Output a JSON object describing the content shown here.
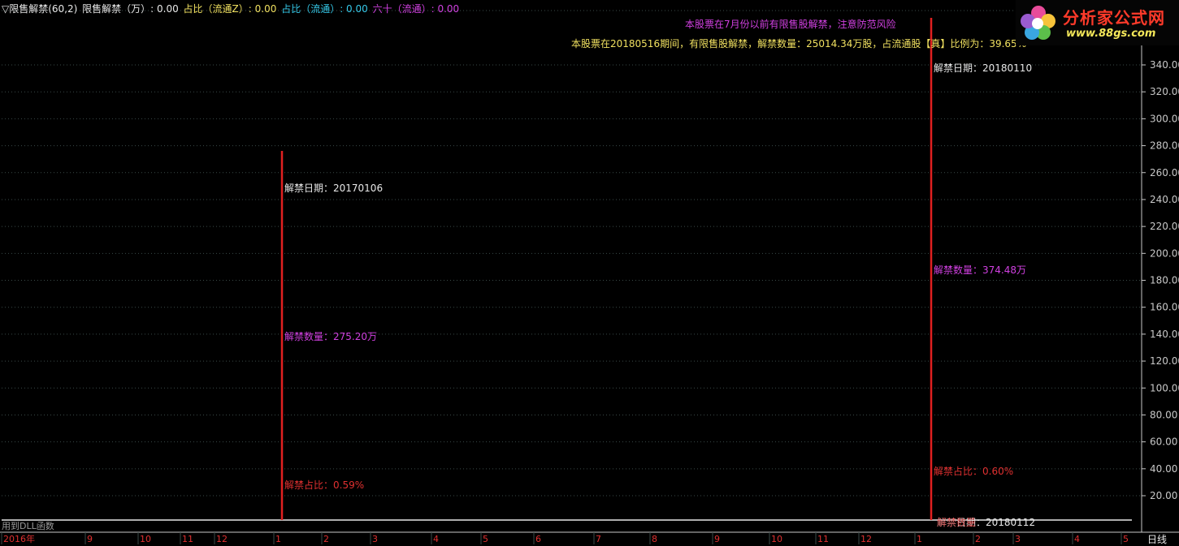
{
  "header": {
    "indicator": "▽限售解禁(60,2)",
    "items": [
      {
        "text": "限售解禁（万）: 0.00",
        "color": "#e8e8e8"
      },
      {
        "text": "占比（流通Z）: 0.00",
        "color": "#f0e060"
      },
      {
        "text": "占比（流通）: 0.00",
        "color": "#35c8e8"
      },
      {
        "text": "六十（流通）: 0.00",
        "color": "#d040e0"
      }
    ]
  },
  "notices": {
    "warning": "本股票在7月份以前有限售股解禁，注意防范风险",
    "detail": "本股票在20180516期间，有限售股解禁，解禁数量：25014.34万股，占流通股【真】比例为：39.65%"
  },
  "logo": {
    "brand": "分析家公式网",
    "url": "www.88gs.com",
    "icon": "flower-logo-icon"
  },
  "footer": {
    "dll_text": "用到DLL函数",
    "period": "日线"
  },
  "colors": {
    "grid": "#3a4a48",
    "axis": "#c8c8c8",
    "event_line": "#e02020",
    "label_white": "#e8e8e8",
    "label_mag": "#d040e0",
    "label_red": "#e03030"
  },
  "chart_data": {
    "type": "bar",
    "ylim": [
      0,
      380
    ],
    "y_ticks": [
      20,
      40,
      60,
      80,
      100,
      120,
      140,
      160,
      180,
      200,
      220,
      240,
      260,
      280,
      300,
      320,
      340
    ],
    "y_tick_labels": [
      "20.00",
      "40.00",
      "60.00",
      "80.00",
      "100.00",
      "120.00",
      "140.00",
      "160.00",
      "180.00",
      "200.00",
      "220.00",
      "240.00",
      "260.00",
      "280.00",
      "300.00",
      "320.00",
      "340.00"
    ],
    "x_ticks": [
      "2016年",
      "9",
      "10",
      "11",
      "12",
      "1",
      "2",
      "3",
      "4",
      "5",
      "6",
      "7",
      "8",
      "9",
      "10",
      "11",
      "12",
      "1",
      "2",
      "3",
      "4",
      "5"
    ],
    "events": [
      {
        "date": "20170106",
        "date_label": "解禁日期：20170106",
        "value": 275.2,
        "qty_label": "解禁数量：275.20万",
        "ratio_label": "解禁占比：0.59%"
      },
      {
        "date": "20180110",
        "date_label": "解禁日期：20180110",
        "value": 374.48,
        "qty_label": "解禁数量：374.48万",
        "ratio_label": "解禁占比：0.60%"
      }
    ],
    "overlap_text": "解禁日期：20180112"
  }
}
